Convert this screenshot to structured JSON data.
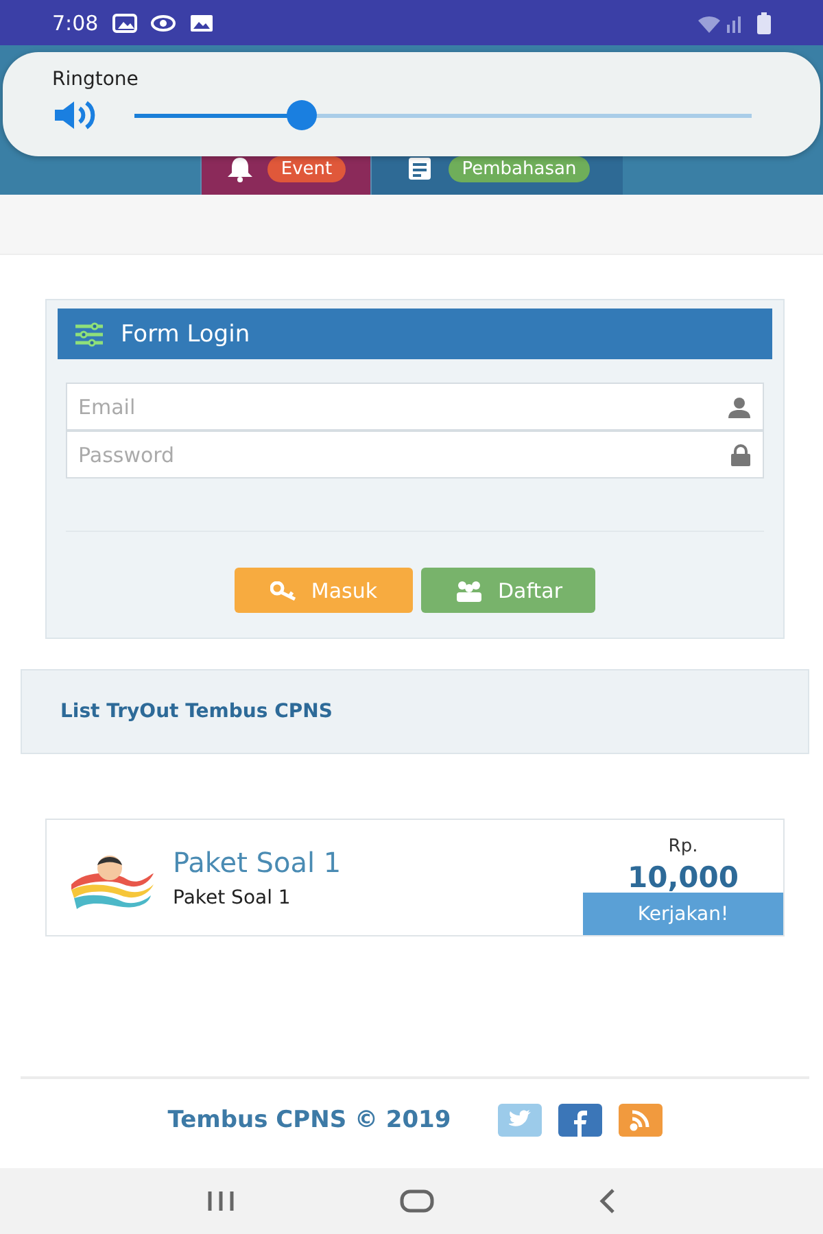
{
  "status_bar": {
    "time": "7:08"
  },
  "volume_popup": {
    "label": "Ringtone",
    "level": 0.27
  },
  "tabs": [
    {
      "label": "Event",
      "kind": "event",
      "selected": true
    },
    {
      "label": "Pembahasan",
      "kind": "discussion",
      "selected": false
    }
  ],
  "login_form": {
    "title": "Form Login",
    "email": {
      "placeholder": "Email"
    },
    "password": {
      "placeholder": "Password"
    },
    "buttons": [
      {
        "label": "Masuk",
        "kind": "login"
      },
      {
        "label": "Daftar",
        "kind": "register"
      }
    ]
  },
  "tryout_list": {
    "title": "List TryOut Tembus CPNS",
    "items": [
      {
        "title": "Paket Soal 1",
        "subtitle": "Paket Soal 1",
        "currency": "Rp.",
        "price": "10,000",
        "action": "Kerjakan!"
      }
    ]
  },
  "footer": {
    "text": "Tembus CPNS © 2019",
    "social": [
      {
        "kind": "twitter"
      },
      {
        "kind": "facebook"
      },
      {
        "kind": "rss"
      }
    ]
  }
}
